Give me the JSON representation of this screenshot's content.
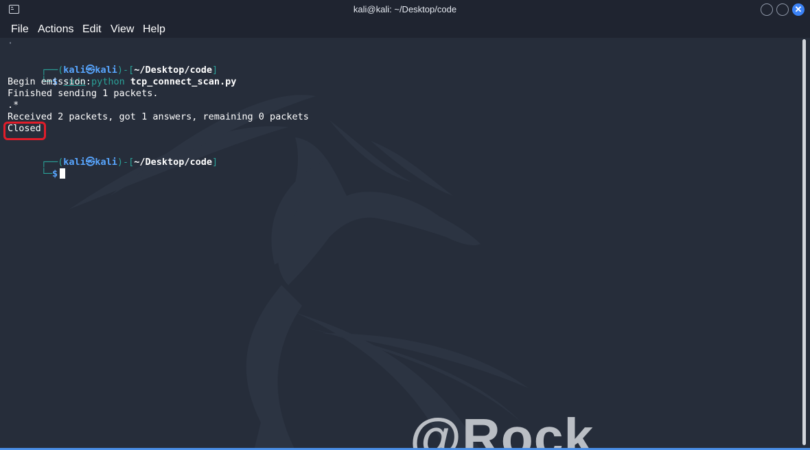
{
  "window": {
    "title": "kali@kali: ~/Desktop/code",
    "icon": "terminal-icon",
    "controls": {
      "minimize": "minimize-icon",
      "maximize": "maximize-icon",
      "close": "close-icon",
      "close_glyph": "✕"
    }
  },
  "menu": {
    "items": [
      "File",
      "Actions",
      "Edit",
      "View",
      "Help"
    ]
  },
  "terminal": {
    "stray_dot": "·",
    "prompt1": {
      "frame_top": "┌──(",
      "user": "kali",
      "at_symbol": "㉿",
      "host": "kali",
      "mid": ")-[",
      "path": "~/Desktop/code",
      "end": "]",
      "frame_bottom": "└─",
      "dollar": "$",
      "cmd_sudo": "sudo",
      "cmd_python": "python",
      "cmd_file": "tcp_connect_scan.py"
    },
    "output": [
      "Begin emission:",
      "Finished sending 1 packets.",
      ".*",
      "Received 2 packets, got 1 answers, remaining 0 packets",
      "Closed"
    ],
    "prompt2": {
      "frame_top": "┌──(",
      "user": "kali",
      "at_symbol": "㉿",
      "host": "kali",
      "mid": ")-[",
      "path": "~/Desktop/code",
      "end": "]",
      "frame_bottom": "└─",
      "dollar": "$"
    },
    "watermark": "@Rock",
    "colors": {
      "prompt_frame": "#2aa198",
      "prompt_user": "#58a6ff",
      "highlight": "#e11d2a",
      "background": "#262d3a"
    }
  }
}
